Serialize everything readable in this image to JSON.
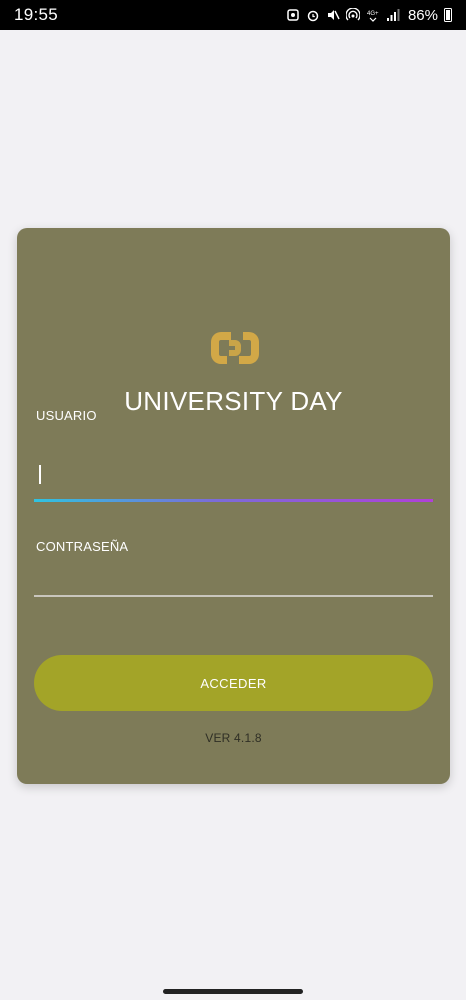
{
  "status_bar": {
    "time": "19:55",
    "battery_pct": "86%",
    "icons": [
      "screenshot-icon",
      "alarm-icon",
      "mute-icon",
      "hotspot-icon",
      "wifi-4g-icon",
      "signal-icon",
      "battery-icon"
    ]
  },
  "login": {
    "app_title": "UNIVERSITY DAY",
    "user_label": "USUARIO",
    "user_value": "",
    "pass_label": "CONTRASEÑA",
    "pass_value": "",
    "submit_label": "ACCEDER",
    "version": "VER 4.1.8"
  },
  "colors": {
    "background": "#f2f1f4",
    "card": "#7e7b58",
    "button": "#a3a428",
    "logo": "#d2a847",
    "focus_gradient_start": "#2fc3e0",
    "focus_gradient_end": "#b040d8"
  }
}
